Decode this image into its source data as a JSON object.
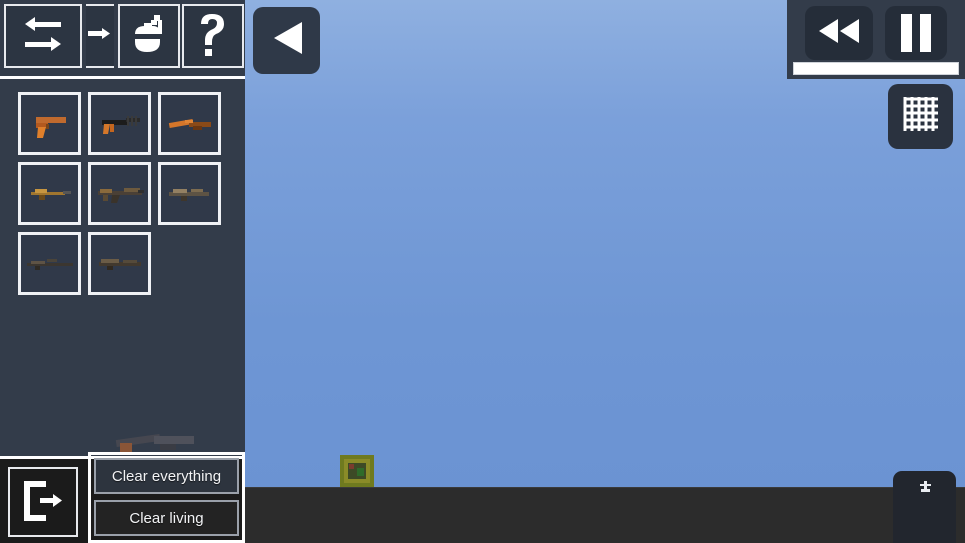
{
  "app": {
    "title": "Sandbox Weapon Spawner",
    "sidebar_bg": "#333c4a",
    "sky_color": "#6e96d4",
    "ground_color": "#2c2c2c",
    "accent_white": "#ffffff"
  },
  "toolbar": {
    "buttons": [
      {
        "name": "swap-tool",
        "icon": "swap-arrows-icon",
        "label": "Swap"
      },
      {
        "name": "next-tool",
        "icon": "arrow-right-icon",
        "label": "Next"
      },
      {
        "name": "grenade-tool",
        "icon": "grenade-icon",
        "label": "Grenade"
      },
      {
        "name": "help-tool",
        "icon": "question-mark-icon",
        "label": "?"
      }
    ]
  },
  "item_grid": {
    "rows": 3,
    "columns": 3,
    "items": [
      {
        "name": "item-pistol",
        "icon": "pistol-icon",
        "label": "Pistol"
      },
      {
        "name": "item-smg",
        "icon": "smg-icon",
        "label": "SMG"
      },
      {
        "name": "item-shotgun",
        "icon": "shotgun-icon",
        "label": "Shotgun"
      },
      {
        "name": "item-carbine",
        "icon": "carbine-icon",
        "label": "Carbine"
      },
      {
        "name": "item-assault-rifle",
        "icon": "assault-rifle-icon",
        "label": "Assault Rifle"
      },
      {
        "name": "item-battle-rifle",
        "icon": "battle-rifle-icon",
        "label": "Battle Rifle"
      },
      {
        "name": "item-sniper-rifle",
        "icon": "sniper-rifle-icon",
        "label": "Sniper Rifle"
      },
      {
        "name": "item-marksman-rifle",
        "icon": "marksman-rifle-icon",
        "label": "Marksman Rifle"
      }
    ]
  },
  "drag": {
    "active_item": "shotgun-icon",
    "label": "Shotgun"
  },
  "sidebar_bottom": {
    "exit": {
      "icon": "exit-door-icon",
      "label": "Exit"
    },
    "clear_everything_label": "Clear everything",
    "clear_living_label": "Clear living"
  },
  "game_controls": {
    "back": {
      "icon": "play-left-triangle-icon",
      "label": "Back"
    },
    "rewind": {
      "icon": "rewind-icon",
      "label": "Rewind"
    },
    "pause": {
      "icon": "pause-icon",
      "label": "Pause"
    },
    "timeline": {
      "name": "timeline-slider",
      "value": "100"
    },
    "grid_toggle": {
      "icon": "grid-icon",
      "label": "Grid"
    },
    "bottom_right": {
      "icon": "anchor-icon",
      "label": "Spawn"
    }
  },
  "world": {
    "object": {
      "name": "crate-object",
      "label": "Crate"
    }
  }
}
